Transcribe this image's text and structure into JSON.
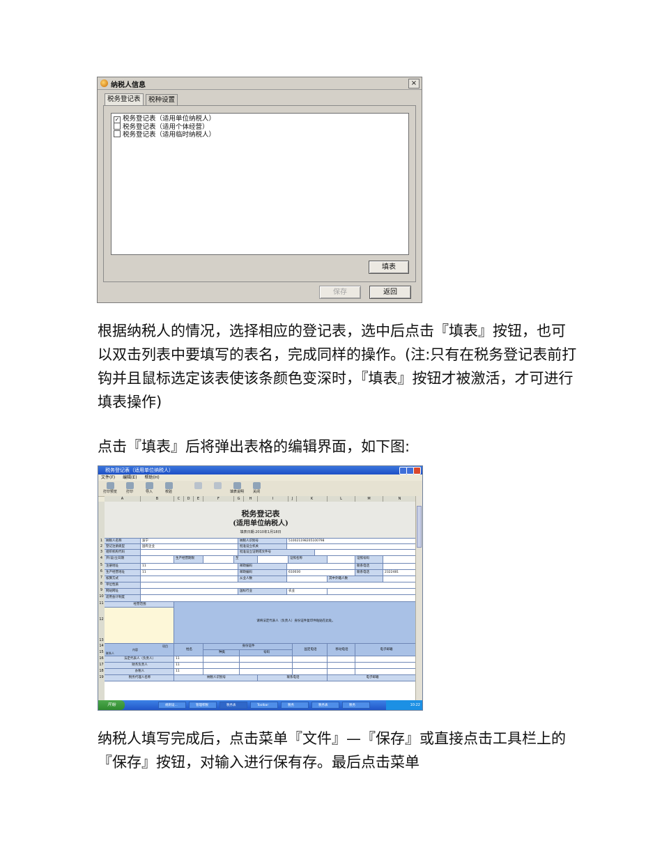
{
  "dialog": {
    "title": "纳税人信息",
    "close": "×",
    "tabs": [
      "税务登记表",
      "税种设置"
    ],
    "items": [
      {
        "label": "税务登记表（适用单位纳税人）",
        "checked": true,
        "mark": "✓"
      },
      {
        "label": "税务登记表（适用个体经营）",
        "checked": false,
        "mark": ""
      },
      {
        "label": "税务登记表（适用临时纳税人）",
        "checked": false,
        "mark": ""
      }
    ],
    "fill_button": "填表",
    "save_button": "保存",
    "back_button": "返回"
  },
  "text": {
    "para1": "根据纳税人的情况，选择相应的登记表，选中后点击『填表』按钮，也可以双击列表中要填写的表名，完成同样的操作。(注:只有在税务登记表前打钩并且鼠标选定该表使该条颜色变深时，『填表』按钮才被激活，才可进行填表操作)",
    "para2": "点击『填表』后将弹出表格的编辑界面，如下图:",
    "para3": "纳税人填写完成后，点击菜单『文件』—『保存』或直接点击工具栏上的『保存』按钮，对输入进行保有存。最后点击菜单"
  },
  "sheet": {
    "window_title": "税务登记表（适用单位纳税人）",
    "menu": [
      "文件(F)",
      "编辑(E)",
      "帮助(H)"
    ],
    "toolbar": [
      "打印预览",
      "打印",
      "导入",
      "校验",
      "",
      "",
      "填表说明",
      "关闭"
    ],
    "columns": [
      "A",
      "B",
      "C",
      "D",
      "E",
      "F",
      "G",
      "H",
      "I",
      "J",
      "K",
      "L",
      "M",
      "N"
    ],
    "row_numbers": [
      "1",
      "2",
      "3",
      "4",
      "5",
      "6",
      "7",
      "8",
      "9",
      "10",
      "11",
      "12",
      "13",
      "14",
      "15",
      "16",
      "17",
      "18",
      "19"
    ],
    "title1": "税务登记表",
    "title2": "(适用单位纳税人)",
    "fill_date": "填表日期:2010年1月18日",
    "labels": {
      "taxpayer_name": "纳税人名称",
      "taxpayer_id": "纳税人识别号",
      "reg_type": "登记注册类型",
      "approver": "批准设立机关",
      "org_code": "组织机构代码",
      "approval_doc": "批准设立证明或文件号",
      "open_date": "开(设)立日期",
      "period": "生产经营期限",
      "to": "至",
      "cert_name": "证照名称",
      "cert_no": "证照号码",
      "reg_addr": "注册地址",
      "post1": "邮政编码",
      "phone1": "联系电话",
      "biz_addr": "生产经营地址",
      "post2": "邮政编码",
      "phone2": "联系电话",
      "accounting": "核算方式",
      "staff": "从业人数",
      "foreign_staff": "其中外籍人数",
      "unit_nature": "单位性质",
      "website": "网站网址",
      "industry": "国标行业",
      "acct_system": "适用会计制度",
      "scope": "经营范围",
      "scope_note": "请将法定代表人（负责人）身份证件复印件粘贴在此处。",
      "item": "项目",
      "content": "内容",
      "contact": "联系人",
      "name": "姓名",
      "id_doc": "身份证件",
      "type": "种类",
      "number": "号码",
      "fixed_phone": "固定电话",
      "mobile": "移动电话",
      "email": "电子邮箱",
      "legal_rep": "法定代表人（负责人）",
      "fin_head": "财务负责人",
      "tax_agent": "办税人",
      "agent_name": "税务代理人名称",
      "agent_id": "纳税人识别号",
      "contact_phone": "联系电话",
      "agent_email": "电子邮箱"
    },
    "values": {
      "taxpayer_name": "波宁",
      "taxpayer_id": "510021198205100798",
      "reg_type": "国有企业",
      "reg_addr": "11",
      "biz_addr": "11",
      "post2": "610030",
      "phone2": "2322481",
      "industry": "农业",
      "legal_rep": "11",
      "fin_head": "11",
      "tax_agent": "11"
    },
    "start": "开始",
    "tasks": [
      "规则设...",
      "管理积税",
      "税务表",
      "Toolbar",
      "税务",
      "税务表",
      "税务"
    ],
    "clock": "10:22"
  }
}
